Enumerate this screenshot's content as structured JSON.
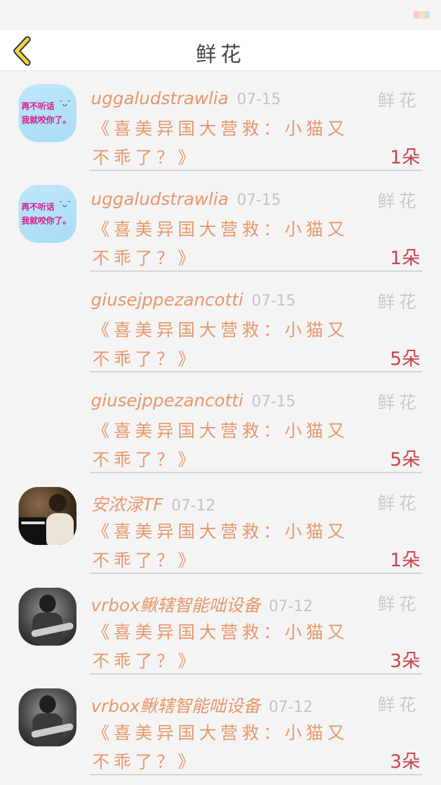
{
  "header": {
    "title": "鲜花"
  },
  "icons": {
    "back": "chevron-left-icon"
  },
  "colors": {
    "accent": "#f0d24a",
    "username": "#e8976b",
    "count": "#c8444e"
  },
  "records": [
    {
      "avatar": {
        "type": "text",
        "line1": "再不听话",
        "line2": "我就咬你了。",
        "face": "˘ᴗ˘"
      },
      "username": "uggaludstrawlia",
      "date": "07-15",
      "gift_label": "鲜花",
      "content": "《喜美异国大营救：小猫又不乖了？》",
      "count": "1朵"
    },
    {
      "avatar": {
        "type": "text",
        "line1": "再不听话",
        "line2": "我就咬你了。",
        "face": "˘ᴗ˘"
      },
      "username": "uggaludstrawlia",
      "date": "07-15",
      "gift_label": "鲜花",
      "content": "《喜美异国大营救：小猫又不乖了？》",
      "count": "1朵"
    },
    {
      "avatar": {
        "type": "none"
      },
      "username": "giusejppezancotti",
      "date": "07-15",
      "gift_label": "鲜花",
      "content": "《喜美异国大营救：小猫又不乖了？》",
      "count": "5朵"
    },
    {
      "avatar": {
        "type": "none"
      },
      "username": "giusejppezancotti",
      "date": "07-15",
      "gift_label": "鲜花",
      "content": "《喜美异国大营救：小猫又不乖了？》",
      "count": "5朵"
    },
    {
      "avatar": {
        "type": "photo1"
      },
      "username": "安浓渌TF",
      "date": "07-12",
      "gift_label": "鲜花",
      "content": "《喜美异国大营救：小猫又不乖了？》",
      "count": "1朵"
    },
    {
      "avatar": {
        "type": "photo2"
      },
      "username": "vrbox鳅辖智能咄设备",
      "date": "07-12",
      "gift_label": "鲜花",
      "content": "《喜美异国大营救：小猫又不乖了？》",
      "count": "3朵"
    },
    {
      "avatar": {
        "type": "photo2"
      },
      "username": "vrbox鳅辖智能咄设备",
      "date": "07-12",
      "gift_label": "鲜花",
      "content": "《喜美异国大营救：小猫又不乖了？》",
      "count": "3朵"
    }
  ]
}
